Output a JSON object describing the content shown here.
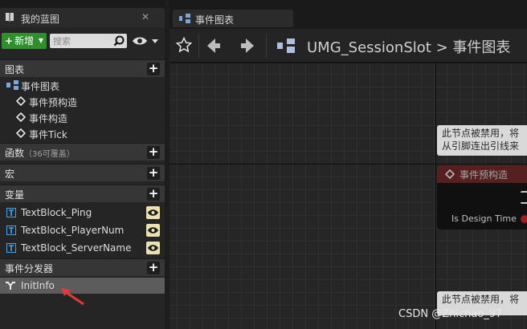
{
  "left_panel": {
    "tab_title": "我的蓝图",
    "close_label": "✕",
    "new_button": {
      "plus": "+",
      "label": "新增"
    },
    "search": {
      "placeholder": "搜索"
    },
    "sections": {
      "graphs": {
        "label": "图表",
        "add": "+"
      },
      "functions": {
        "label": "函数",
        "sub": "（36可覆盖）",
        "add": "+"
      },
      "macros": {
        "label": "宏",
        "add": "+"
      },
      "variables": {
        "label": "变量",
        "add": "+"
      },
      "dispatchers": {
        "label": "事件分发器",
        "add": "+"
      }
    },
    "graph_items": {
      "event_graph": "事件图表",
      "events": [
        "事件预构造",
        "事件构造",
        "事件Tick"
      ]
    },
    "variable_items": [
      "TextBlock_Ping",
      "TextBlock_PlayerNum",
      "TextBlock_ServerName"
    ],
    "dispatcher_items": [
      "InitInfo"
    ]
  },
  "graph_editor": {
    "tab_title": "事件图表",
    "breadcrumb": {
      "blueprint": "UMG_SessionSlot",
      "separator": ">",
      "graph": "事件图表"
    },
    "node": {
      "title": "事件预构造",
      "pin_label": "Is Design Time"
    },
    "notes": [
      {
        "line1": "此节点被禁用，将",
        "line2": "从引脚连出引线来"
      },
      {
        "line1": "此节点被禁用，将",
        "line2": ""
      }
    ]
  },
  "watermark": "CSDN @Zhichao_97",
  "colors": {
    "accent_green": "#2f8f2a",
    "selection_gray": "#5c5c5c",
    "node_header_red": "#5a1f1f",
    "annotation_arrow_red": "#e53935"
  }
}
